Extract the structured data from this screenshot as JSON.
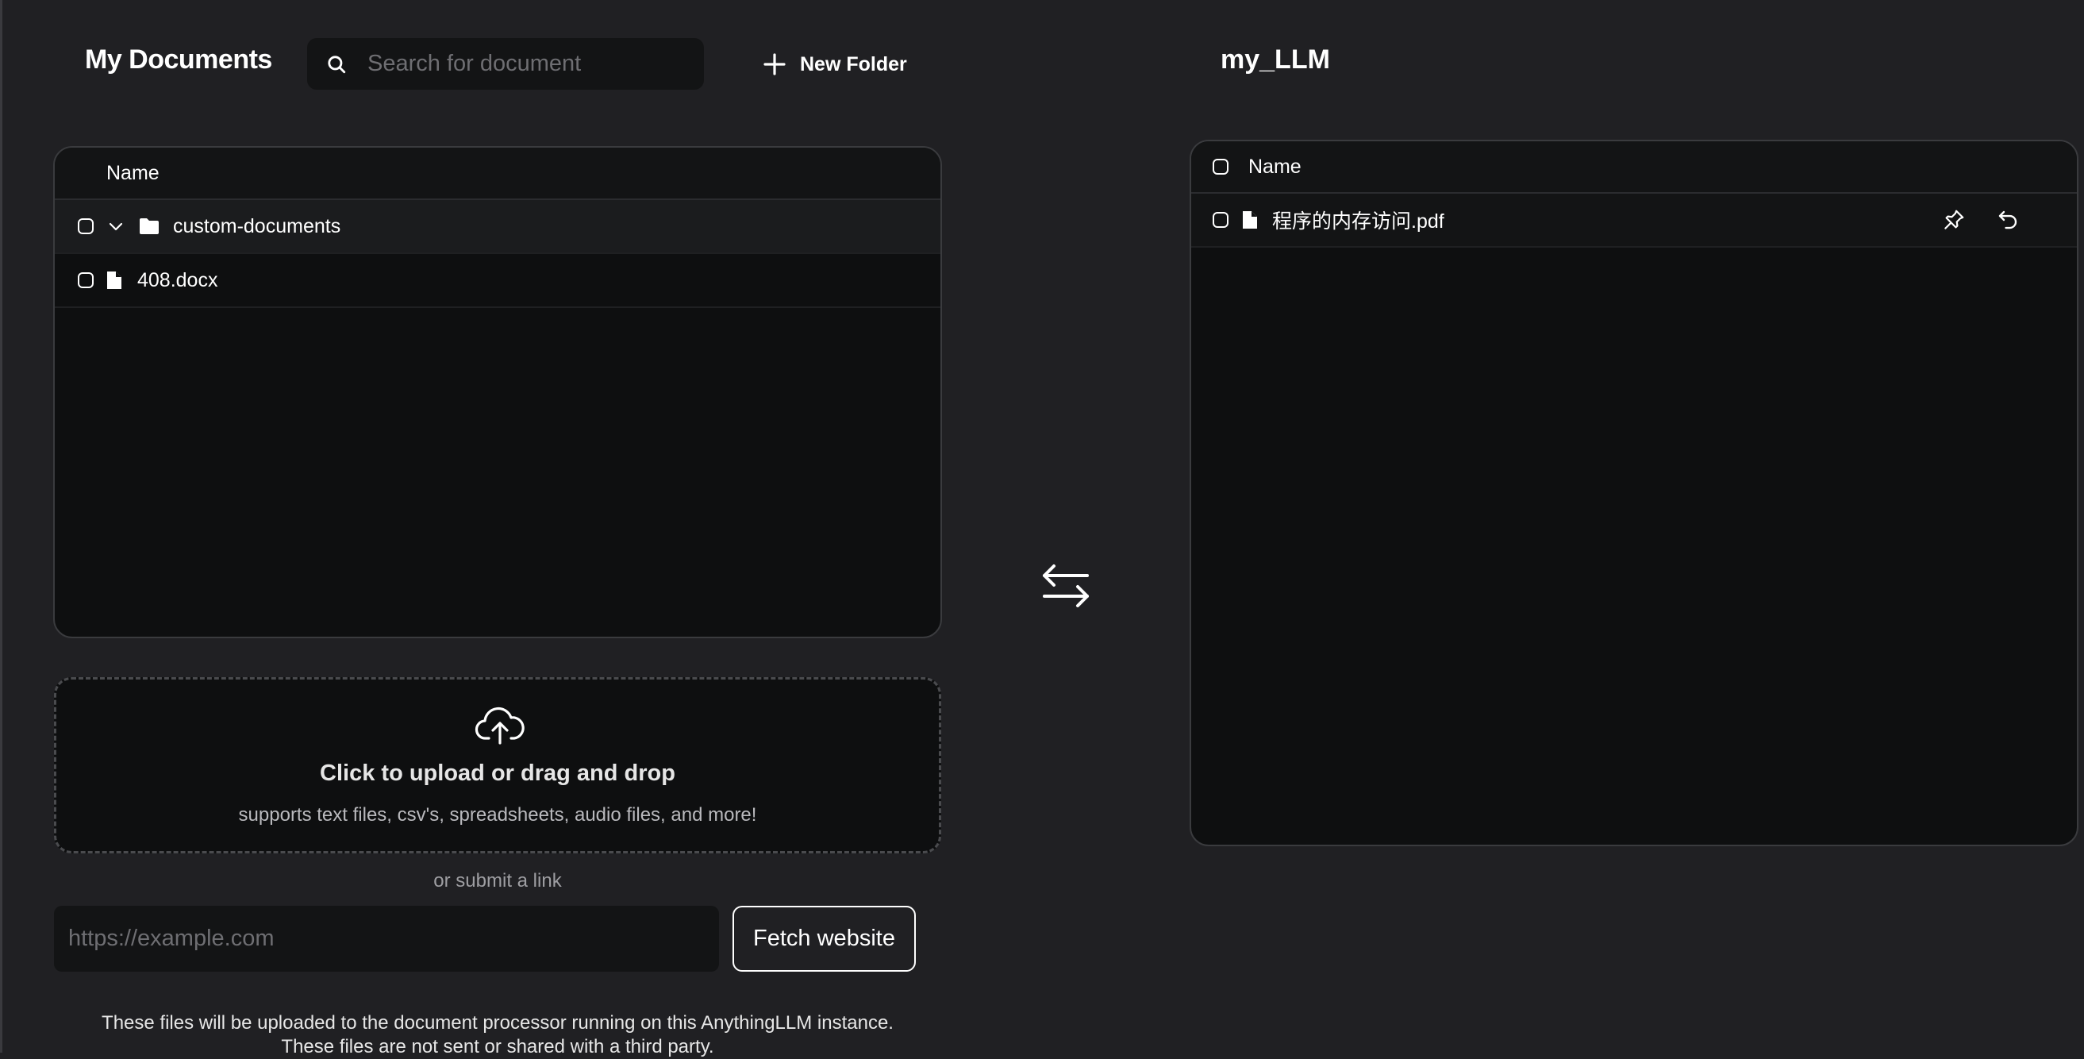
{
  "header": {
    "title": "My Documents",
    "search_placeholder": "Search for document",
    "new_folder_label": "New Folder",
    "workspace_title": "my_LLM"
  },
  "my_documents": {
    "column_name": "Name",
    "items": [
      {
        "type": "folder",
        "name": "custom-documents",
        "expanded": true
      },
      {
        "type": "file",
        "name": "408.docx"
      }
    ]
  },
  "workspace": {
    "column_name": "Name",
    "items": [
      {
        "type": "file",
        "name": "程序的内存访问.pdf"
      }
    ]
  },
  "upload": {
    "title": "Click to upload or drag and drop",
    "subtitle": "supports text files, csv's, spreadsheets, audio files, and more!",
    "or_link": "or submit a link",
    "url_placeholder": "https://example.com",
    "fetch_label": "Fetch website",
    "disclaimer_line1": "These files will be uploaded to the document processor running on this AnythingLLM instance.",
    "disclaimer_line2": "These files are not sent or shared with a third party."
  }
}
